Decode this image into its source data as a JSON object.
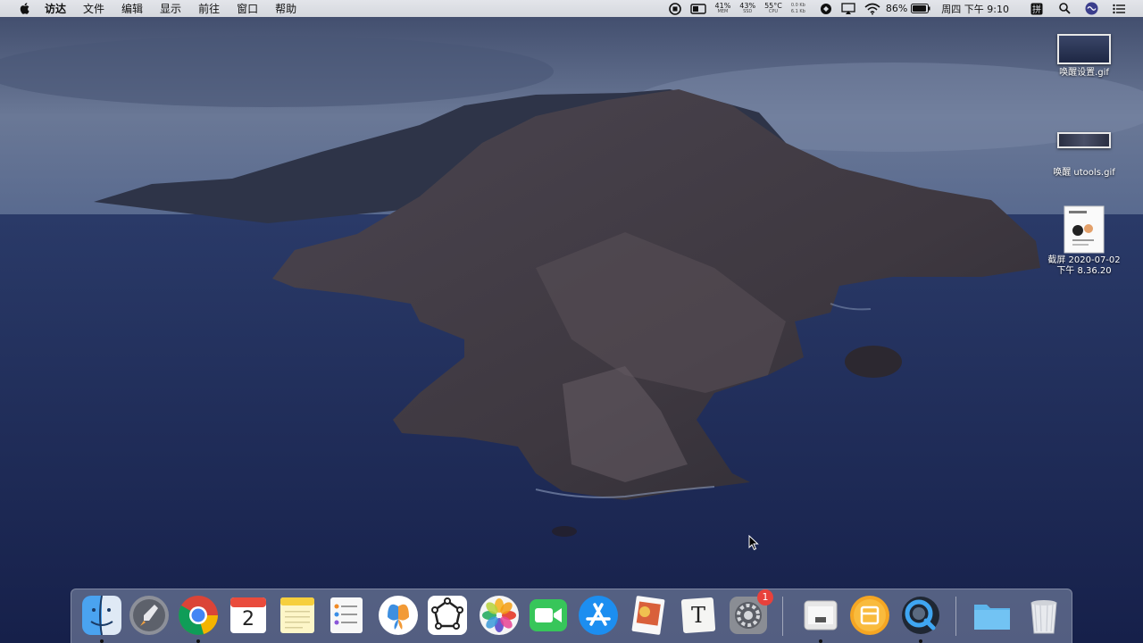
{
  "menubar": {
    "apple_icon": "apple-logo-icon",
    "items": [
      "访达",
      "文件",
      "编辑",
      "显示",
      "前往",
      "窗口",
      "帮助"
    ],
    "status": {
      "mem_pct": "41%",
      "mem_label": "MEM",
      "cpu_pct": "43%",
      "cpu_label": "SSD",
      "temp": "55°C",
      "temp_label": "CPU",
      "net_up": "0.0 Kb",
      "net_down": "6.1 Kb",
      "battery_pct": "86%",
      "clock": "周四 下午 9:10"
    }
  },
  "desktop": {
    "files": [
      {
        "name": "唤醒设置.gif",
        "icon": "gif-thumbnail-icon"
      },
      {
        "name": "唤醒 utools.gif",
        "icon": "gif-thumbnail-icon"
      },
      {
        "name": "截屏 2020-07-02\n下午 8.36.20",
        "icon": "screenshot-thumbnail-icon"
      }
    ]
  },
  "dock": {
    "apps": [
      {
        "name": "finder-icon",
        "running": true
      },
      {
        "name": "launchpad-icon",
        "running": false
      },
      {
        "name": "chrome-icon",
        "running": true
      },
      {
        "name": "calendar-icon",
        "running": false,
        "day": "2"
      },
      {
        "name": "notes-icon",
        "running": false
      },
      {
        "name": "reminders-icon",
        "running": false
      },
      {
        "name": "butterfly-app-icon",
        "running": false
      },
      {
        "name": "graph-app-icon",
        "running": false
      },
      {
        "name": "photos-icon",
        "running": false
      },
      {
        "name": "facetime-icon",
        "running": false
      },
      {
        "name": "app-store-icon",
        "running": false
      },
      {
        "name": "preview-icon",
        "running": false
      },
      {
        "name": "typora-icon",
        "running": false,
        "letter": "T"
      },
      {
        "name": "system-preferences-icon",
        "running": false,
        "badge": "1"
      },
      {
        "name": "simulator-app-icon",
        "running": true
      },
      {
        "name": "utools-icon",
        "running": false
      },
      {
        "name": "quicktime-icon",
        "running": true
      },
      {
        "name": "folder-icon",
        "running": false
      },
      {
        "name": "trash-icon",
        "running": false
      }
    ]
  },
  "colors": {
    "sea": "#1d2a52",
    "sky": "#5a6a8c",
    "island": "#3e3a44",
    "menubar": "#dcdfe4"
  }
}
